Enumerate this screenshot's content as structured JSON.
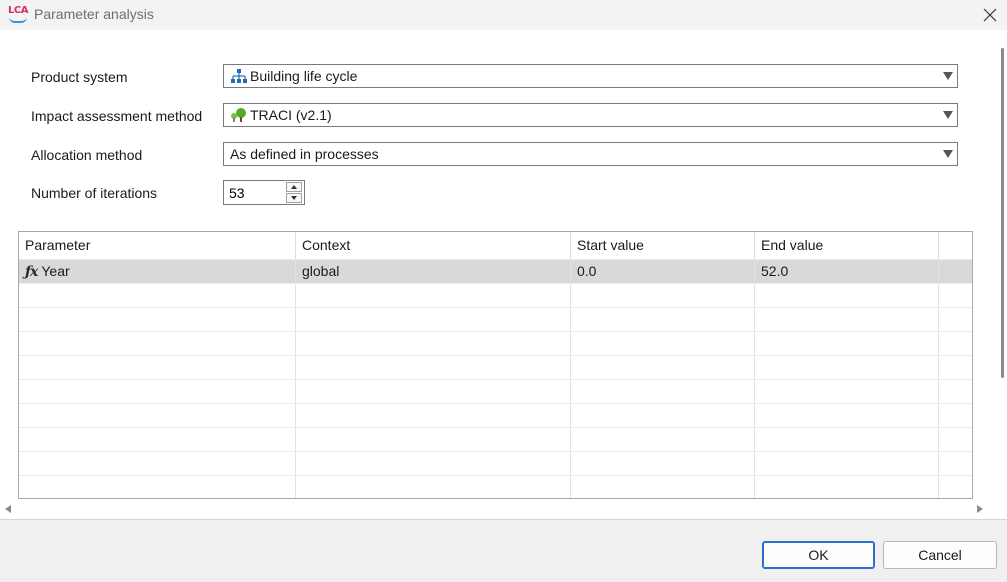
{
  "window": {
    "title": "Parameter analysis",
    "app_icon_text": "LCA"
  },
  "form": {
    "product_system": {
      "label": "Product system",
      "value": "Building life cycle",
      "icon": "product-system-icon"
    },
    "impact_method": {
      "label": "Impact assessment method",
      "value": "TRACI (v2.1)",
      "icon": "impact-method-icon"
    },
    "allocation": {
      "label": "Allocation method",
      "value": "As defined in processes"
    },
    "iterations": {
      "label": "Number of iterations",
      "value": "53"
    }
  },
  "table": {
    "columns": [
      "Parameter",
      "Context",
      "Start value",
      "End value"
    ],
    "rows": [
      {
        "parameter": "Year",
        "context": "global",
        "start": "0.0",
        "end": "52.0",
        "icon": "fx-icon",
        "selected": true
      }
    ]
  },
  "buttons": {
    "ok": "OK",
    "cancel": "Cancel"
  },
  "colors": {
    "accent": "#2a6fcf",
    "selection": "#d9d9d9",
    "product_icon": "#1f6fb8",
    "method_icon": "#5aa832"
  }
}
